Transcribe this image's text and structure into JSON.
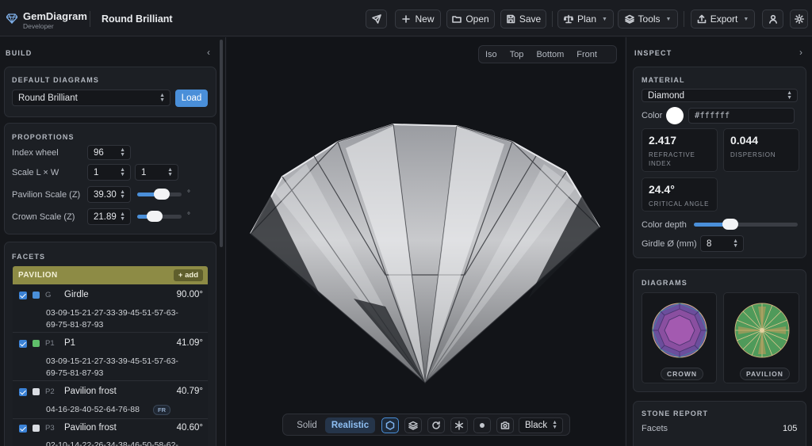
{
  "app": {
    "name": "GemDiagram",
    "subtitle": "Developer",
    "document_title": "Round Brilliant"
  },
  "toolbar": {
    "new": "New",
    "open": "Open",
    "save": "Save",
    "plan": "Plan",
    "tools": "Tools",
    "export": "Export"
  },
  "left": {
    "panel_title": "BUILD",
    "default_diagrams": {
      "title": "DEFAULT DIAGRAMS",
      "selected": "Round Brilliant",
      "load": "Load"
    },
    "proportions": {
      "title": "PROPORTIONS",
      "index_wheel_label": "Index wheel",
      "index_wheel": "96",
      "scale_label": "Scale L × W",
      "scale_l": "1",
      "scale_w": "1",
      "pavilion_scale_label": "Pavilion Scale (Z)",
      "pavilion_scale": "39.30",
      "pavilion_level": 0.55,
      "crown_scale_label": "Crown Scale (Z)",
      "crown_scale": "21.89",
      "crown_level": 0.4,
      "unit": "°"
    },
    "facets": {
      "title": "FACETS",
      "group": "PAVILION",
      "add": "+ add",
      "rows": [
        {
          "id": "G",
          "name": "Girdle",
          "angle": "90.00°",
          "color": "#4a8fd9",
          "idx1": "03-09-15-21-27-33-39-45-51-57-63-",
          "idx2": "69-75-81-87-93",
          "badge": ""
        },
        {
          "id": "P1",
          "name": "P1",
          "angle": "41.09°",
          "color": "#5fbf6a",
          "idx1": "03-09-15-21-27-33-39-45-51-57-63-",
          "idx2": "69-75-81-87-93",
          "badge": ""
        },
        {
          "id": "P2",
          "name": "Pavilion frost",
          "angle": "40.79°",
          "color": "#d9dce2",
          "idx1": "04-16-28-40-52-64-76-88",
          "idx2": "",
          "badge": "FR"
        },
        {
          "id": "P3",
          "name": "Pavilion frost",
          "angle": "40.60°",
          "color": "#d9dce2",
          "idx1": "02-10-14-22-26-34-38-46-50-58-62-",
          "idx2": "",
          "badge": ""
        }
      ]
    }
  },
  "viewport": {
    "views": [
      "Iso",
      "Top",
      "Bottom",
      "Front"
    ],
    "modes": [
      "Solid",
      "Realistic"
    ],
    "active_mode": "Realistic",
    "background": "Black"
  },
  "right": {
    "panel_title": "INSPECT",
    "material": {
      "title": "MATERIAL",
      "selected": "Diamond",
      "color_label": "Color",
      "color_hex": "#ffffff",
      "ri": "2.417",
      "ri_label1": "REFRACTIVE",
      "ri_label2": "INDEX",
      "dispersion": "0.044",
      "dispersion_label": "DISPERSION",
      "critical": "24.4°",
      "critical_label": "CRITICAL ANGLE",
      "color_depth_label": "Color depth",
      "color_depth_level": 0.35,
      "girdle_label": "Girdle Ø (mm)",
      "girdle": "8"
    },
    "diagrams": {
      "title": "DIAGRAMS",
      "crown": "CROWN",
      "pavilion": "PAVILION"
    },
    "report": {
      "title": "STONE REPORT",
      "facets_label": "Facets",
      "facets_value": "105"
    }
  },
  "colors": {
    "accent": "#4a8fd9",
    "pavilion_header": "#8d8b45"
  }
}
